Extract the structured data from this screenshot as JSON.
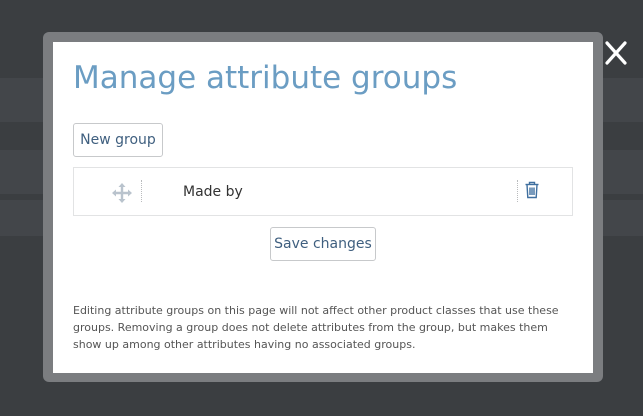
{
  "modal": {
    "title": "Manage attribute groups",
    "new_group_label": "New group",
    "save_label": "Save changes",
    "help_text": "Editing attribute groups on this page will not affect other product classes that use these groups. Removing a group does not delete attributes from the group, but makes them show up among other attributes having no associated groups."
  },
  "groups": [
    {
      "name": "Made by"
    }
  ],
  "icons": {
    "close": "close-icon",
    "drag": "move-arrows-icon",
    "delete": "trash-icon"
  },
  "colors": {
    "title": "#6b9dc3",
    "button_text": "#3f5f7f",
    "delete_icon": "#3f6f9f",
    "overlay": "#3b3e41",
    "modal_frame": "#7b7d80"
  }
}
